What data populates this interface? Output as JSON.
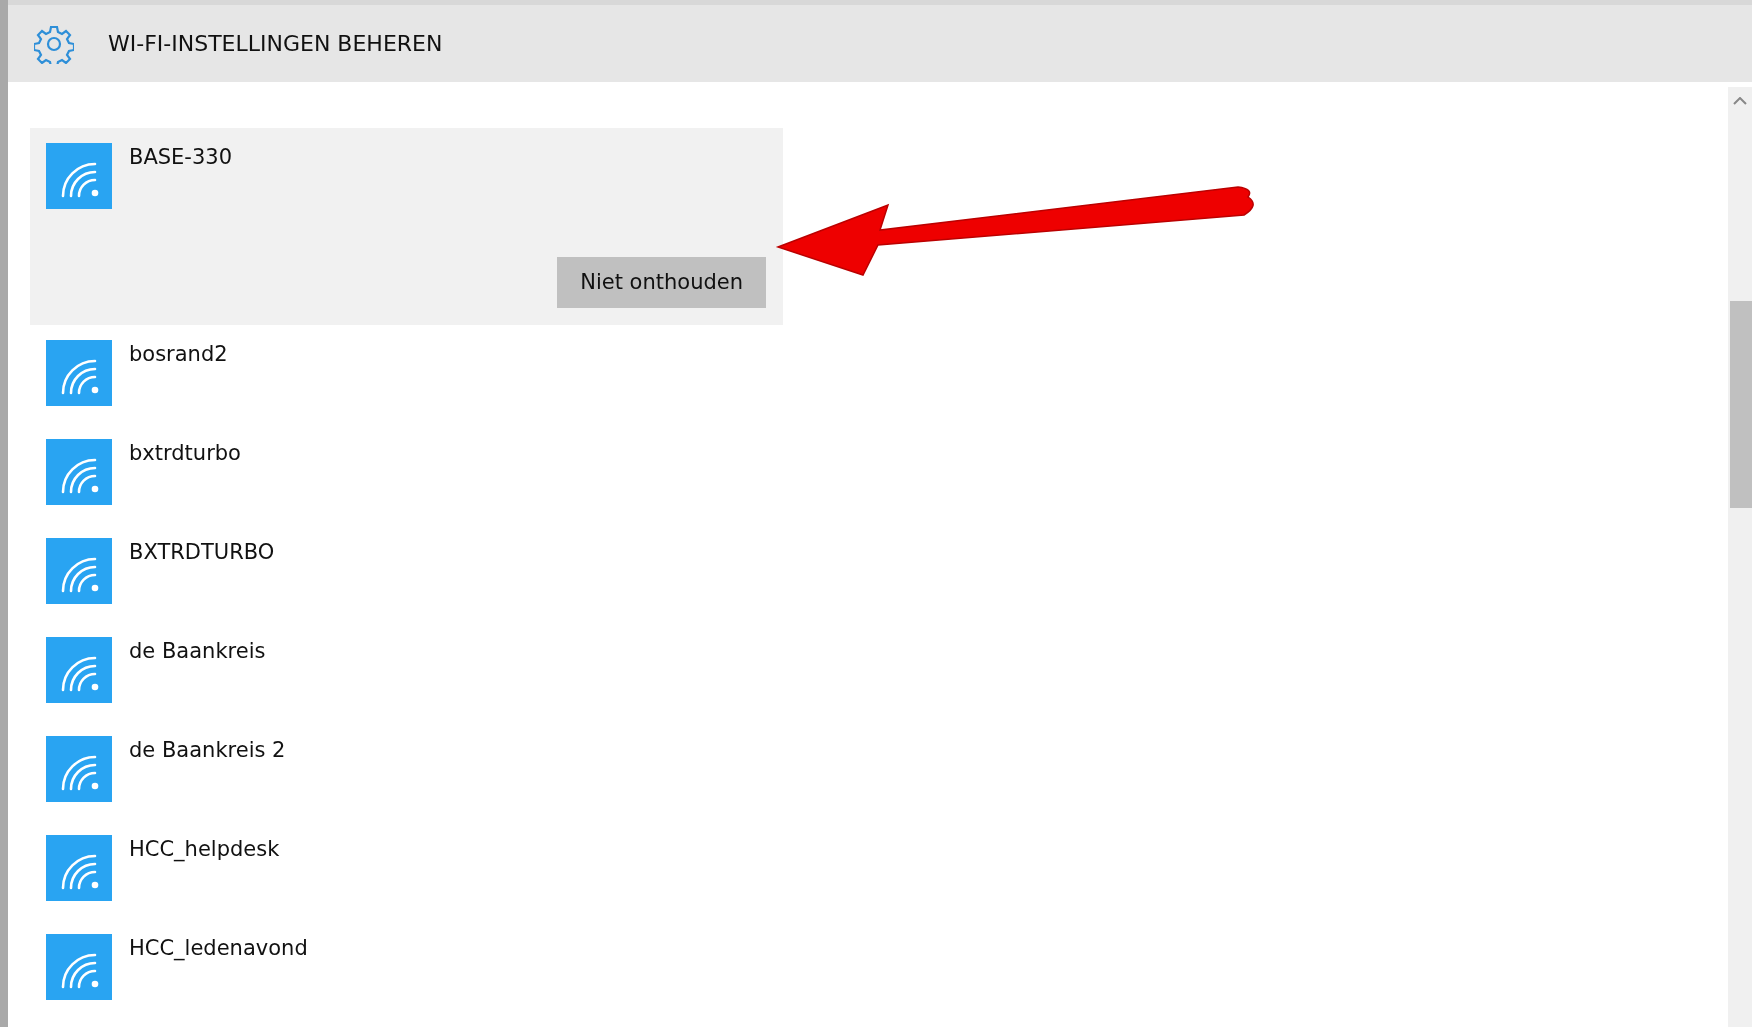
{
  "window": {
    "title": "WI-FI-INSTELLINGEN BEHEREN"
  },
  "networks": [
    {
      "name": "BASE-330",
      "selected": true,
      "action": "Niet onthouden"
    },
    {
      "name": "bosrand2",
      "selected": false
    },
    {
      "name": "bxtrdturbo",
      "selected": false
    },
    {
      "name": "BXTRDTURBO",
      "selected": false
    },
    {
      "name": "de Baankreis",
      "selected": false
    },
    {
      "name": "de Baankreis 2",
      "selected": false
    },
    {
      "name": "HCC_helpdesk",
      "selected": false
    },
    {
      "name": "HCC_ledenavond",
      "selected": false
    }
  ]
}
